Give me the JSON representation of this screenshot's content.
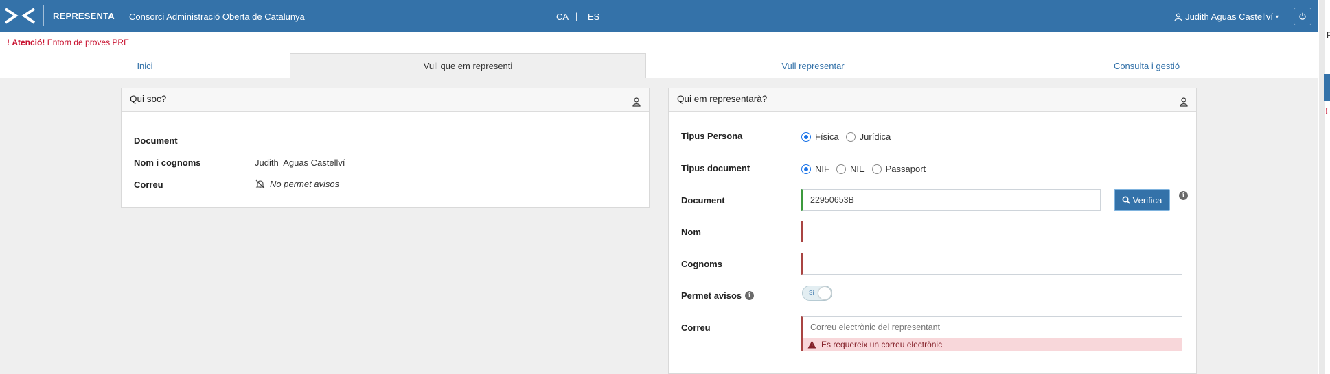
{
  "header": {
    "app_name": "REPRESENTA",
    "organization": "Consorci Administració Oberta de Catalunya",
    "lang_ca": "CA",
    "lang_separator": "|",
    "lang_es": "ES",
    "user_name": "Judith Aguas Castellví",
    "accent_color": "#3472a9"
  },
  "warning": {
    "mark": "!",
    "title": "Atenció!",
    "text": "Entorn de proves PRE"
  },
  "tabs": [
    {
      "label": "Inici",
      "active": false
    },
    {
      "label": "Vull que em representi",
      "active": true
    },
    {
      "label": "Vull representar",
      "active": false
    },
    {
      "label": "Consulta i gestió",
      "active": false
    }
  ],
  "left_panel": {
    "title": "Qui soc?",
    "rows": [
      {
        "label": "Document",
        "value": ""
      },
      {
        "label": "Nom i cognoms",
        "value": "Judith  Aguas Castellví"
      },
      {
        "label": "Correu",
        "value": "No permet avisos"
      }
    ]
  },
  "right_panel": {
    "title": "Qui em representarà?",
    "person_type": {
      "label": "Tipus Persona",
      "options": [
        "Física",
        "Jurídica"
      ],
      "selected": "Física"
    },
    "document_type": {
      "label": "Tipus document",
      "options": [
        "NIF",
        "NIE",
        "Passaport"
      ],
      "selected": "NIF"
    },
    "document": {
      "label": "Document",
      "value": "22950653B",
      "button": "Verifica"
    },
    "name": {
      "label": "Nom",
      "value": ""
    },
    "surnames": {
      "label": "Cognoms",
      "value": ""
    },
    "notices": {
      "label": "Permet avisos",
      "toggle_text": "Sí",
      "enabled": true
    },
    "email": {
      "label": "Correu",
      "placeholder": "Correu electrònic del representant",
      "error": "Es requereix un correu electrònic"
    }
  },
  "edge_fragments": {
    "text_one": "P",
    "text_two": "!"
  }
}
